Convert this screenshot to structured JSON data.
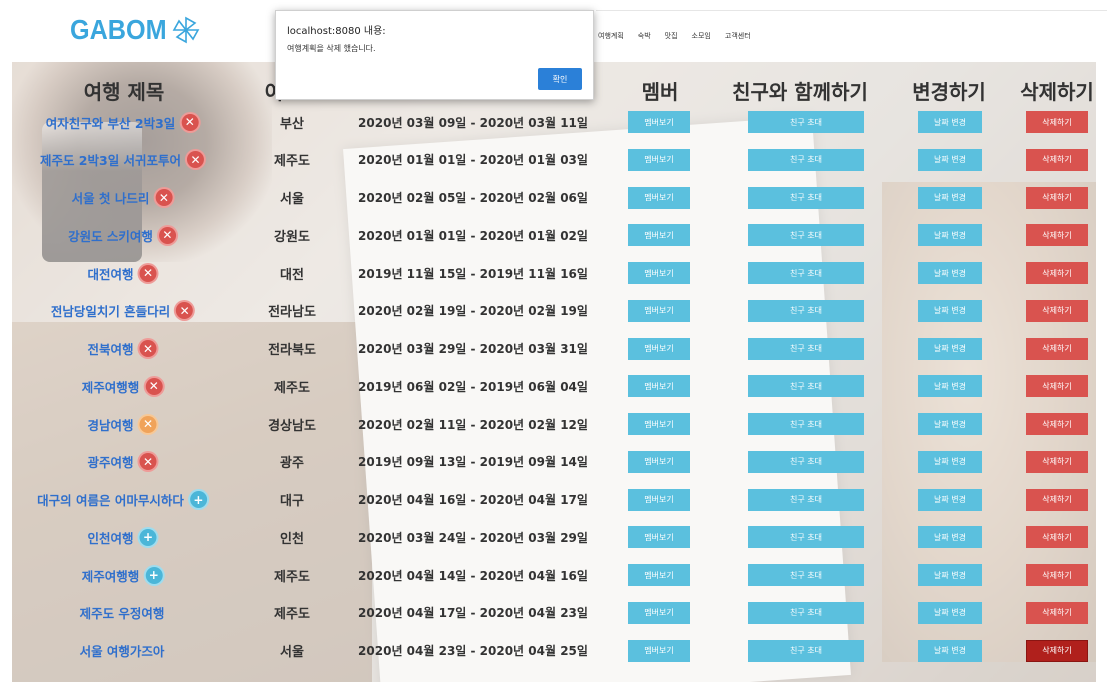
{
  "header": {
    "logo_text": "GABOM",
    "nav": [
      "여행계획",
      "숙박",
      "맛집",
      "소모임",
      "고객센터"
    ]
  },
  "alert": {
    "origin": "localhost:8080 내용:",
    "message": "여행계획을 삭제 했습니다.",
    "ok_label": "확인"
  },
  "table": {
    "headers": {
      "title": "여행 제목",
      "destination": "여",
      "member": "멤버",
      "with_friends": "친구와 함께하기",
      "change": "변경하기",
      "delete": "삭제하기"
    },
    "buttons": {
      "member": "멤버보기",
      "invite": "친구 초대",
      "change_date": "날짜 변경",
      "delete": "삭제하기"
    },
    "rows": [
      {
        "title": "여자친구와 부산 2박3일",
        "destination": "부산",
        "dates": "2020년 03월 09일 - 2020년 03월 11일",
        "icon": "remove-icon"
      },
      {
        "title": "제주도 2박3일 서귀포투어",
        "destination": "제주도",
        "dates": "2020년 01월 01일 - 2020년 01월 03일",
        "icon": "remove-icon"
      },
      {
        "title": "서울 첫 나드리",
        "destination": "서울",
        "dates": "2020년 02월 05일 - 2020년 02월 06일",
        "icon": "remove-icon"
      },
      {
        "title": "강원도 스키여행",
        "destination": "강원도",
        "dates": "2020년 01월 01일 - 2020년 01월 02일",
        "icon": "remove-icon"
      },
      {
        "title": "대전여행",
        "destination": "대전",
        "dates": "2019년 11월 15일 - 2019년 11월 16일",
        "icon": "remove-icon"
      },
      {
        "title": "전남당일치기 흔들다리",
        "destination": "전라남도",
        "dates": "2020년 02월 19일 - 2020년 02월 19일",
        "icon": "remove-icon"
      },
      {
        "title": "전북여행",
        "destination": "전라북도",
        "dates": "2020년 03월 29일 - 2020년 03월 31일",
        "icon": "remove-icon"
      },
      {
        "title": "제주여행행",
        "destination": "제주도",
        "dates": "2019년 06월 02일 - 2019년 06월 04일",
        "icon": "remove-icon"
      },
      {
        "title": "경남여행",
        "destination": "경상남도",
        "dates": "2020년 02월 11일 - 2020년 02월 12일",
        "icon": "remove-icon-hover"
      },
      {
        "title": "광주여행",
        "destination": "광주",
        "dates": "2019년 09월 13일 - 2019년 09월 14일",
        "icon": "remove-icon"
      },
      {
        "title": "대구의 여름은 어마무시하다",
        "destination": "대구",
        "dates": "2020년 04월 16일 - 2020년 04월 17일",
        "icon": "add-icon"
      },
      {
        "title": "인천여행",
        "destination": "인천",
        "dates": "2020년 03월 24일 - 2020년 03월 29일",
        "icon": "add-icon"
      },
      {
        "title": "제주여행행",
        "destination": "제주도",
        "dates": "2020년 04월 14일 - 2020년 04월 16일",
        "icon": "add-icon"
      },
      {
        "title": "제주도 우정여행",
        "destination": "제주도",
        "dates": "2020년 04월 17일 - 2020년 04월 23일",
        "icon": "none"
      },
      {
        "title": "서울 여행가즈아",
        "destination": "서울",
        "dates": "2020년 04월 23일 - 2020년 04월 25일",
        "icon": "none"
      }
    ]
  },
  "colors": {
    "accent": "#5bc0de",
    "danger": "#d9534f",
    "logo": "#3aa6dd",
    "link": "#2f6fcc"
  }
}
